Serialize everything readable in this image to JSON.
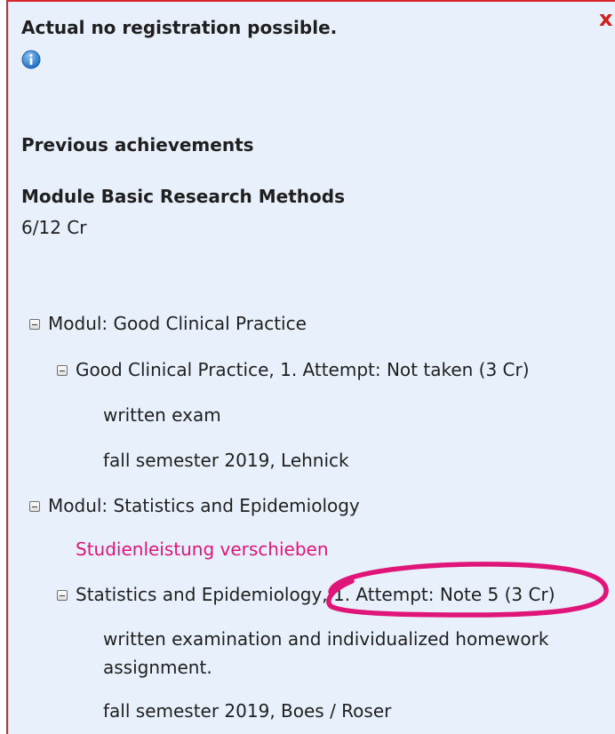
{
  "notice": {
    "title": "Actual no registration possible.",
    "info_icon": "info-icon",
    "close_icon": "close-icon",
    "close_glyph": "x"
  },
  "achievements": {
    "heading": "Previous achievements",
    "module_title": "Module Basic Research Methods",
    "credits": "6/12 Cr"
  },
  "tree": {
    "module1": {
      "label": "Modul: Good Clinical Practice",
      "course": {
        "label": "Good Clinical Practice, 1. Attempt: Not taken (3 Cr)",
        "exam": "written exam",
        "semester": "fall semester 2019, Lehnick"
      }
    },
    "module2": {
      "label": "Modul: Statistics and Epidemiology",
      "action_link": "Studienleistung verschieben",
      "course": {
        "label": "Statistics and Epidemiology, 1. Attempt: Note 5 (3 Cr)",
        "exam_line1": "written examination and individualized homework",
        "exam_line2": "assignment.",
        "semester": "fall semester 2019, Boes / Roser"
      }
    }
  },
  "colors": {
    "panel_background": "#e8f1fb",
    "panel_border": "#d9262c",
    "link": "#e0157a",
    "highlight_ellipse": "#e0157a",
    "info_icon": "#2f7fd4"
  }
}
